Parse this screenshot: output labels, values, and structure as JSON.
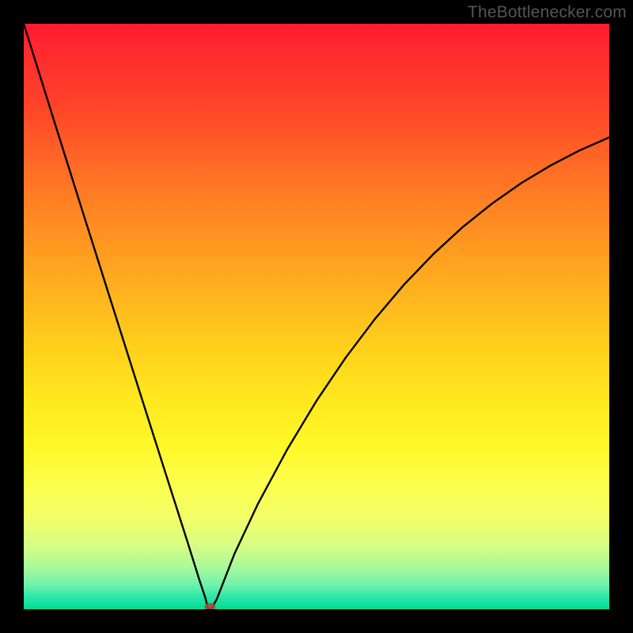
{
  "watermark": {
    "text": "TheBottlenecker.com"
  },
  "colors": {
    "gradient_top": "#ff1a33",
    "gradient_bottom": "#00dd95",
    "curve_stroke": "#000000",
    "marker_fill": "#b34a3c",
    "frame": "#000000"
  },
  "chart_data": {
    "type": "line",
    "title": "",
    "xlabel": "",
    "ylabel": "",
    "xlim": [
      0,
      100
    ],
    "ylim": [
      0,
      100
    ],
    "legend": null,
    "grid": false,
    "annotations": [],
    "series": [
      {
        "name": "bottleneck-curve",
        "x": [
          0,
          5,
          10,
          15,
          20,
          25,
          28,
          30,
          31,
          31.5,
          32,
          33,
          36,
          40,
          45,
          50,
          55,
          60,
          65,
          70,
          75,
          80,
          85,
          90,
          95,
          100
        ],
        "values": [
          100,
          84,
          68.1,
          52.3,
          36.5,
          20.8,
          11.4,
          5,
          2,
          0,
          0,
          1.8,
          9.5,
          18,
          27.3,
          35.6,
          43,
          49.6,
          55.5,
          60.7,
          65.3,
          69.3,
          72.8,
          75.8,
          78.4,
          80.6
        ]
      }
    ],
    "bottleneck_min": {
      "x": 31.8,
      "y": 0
    }
  }
}
